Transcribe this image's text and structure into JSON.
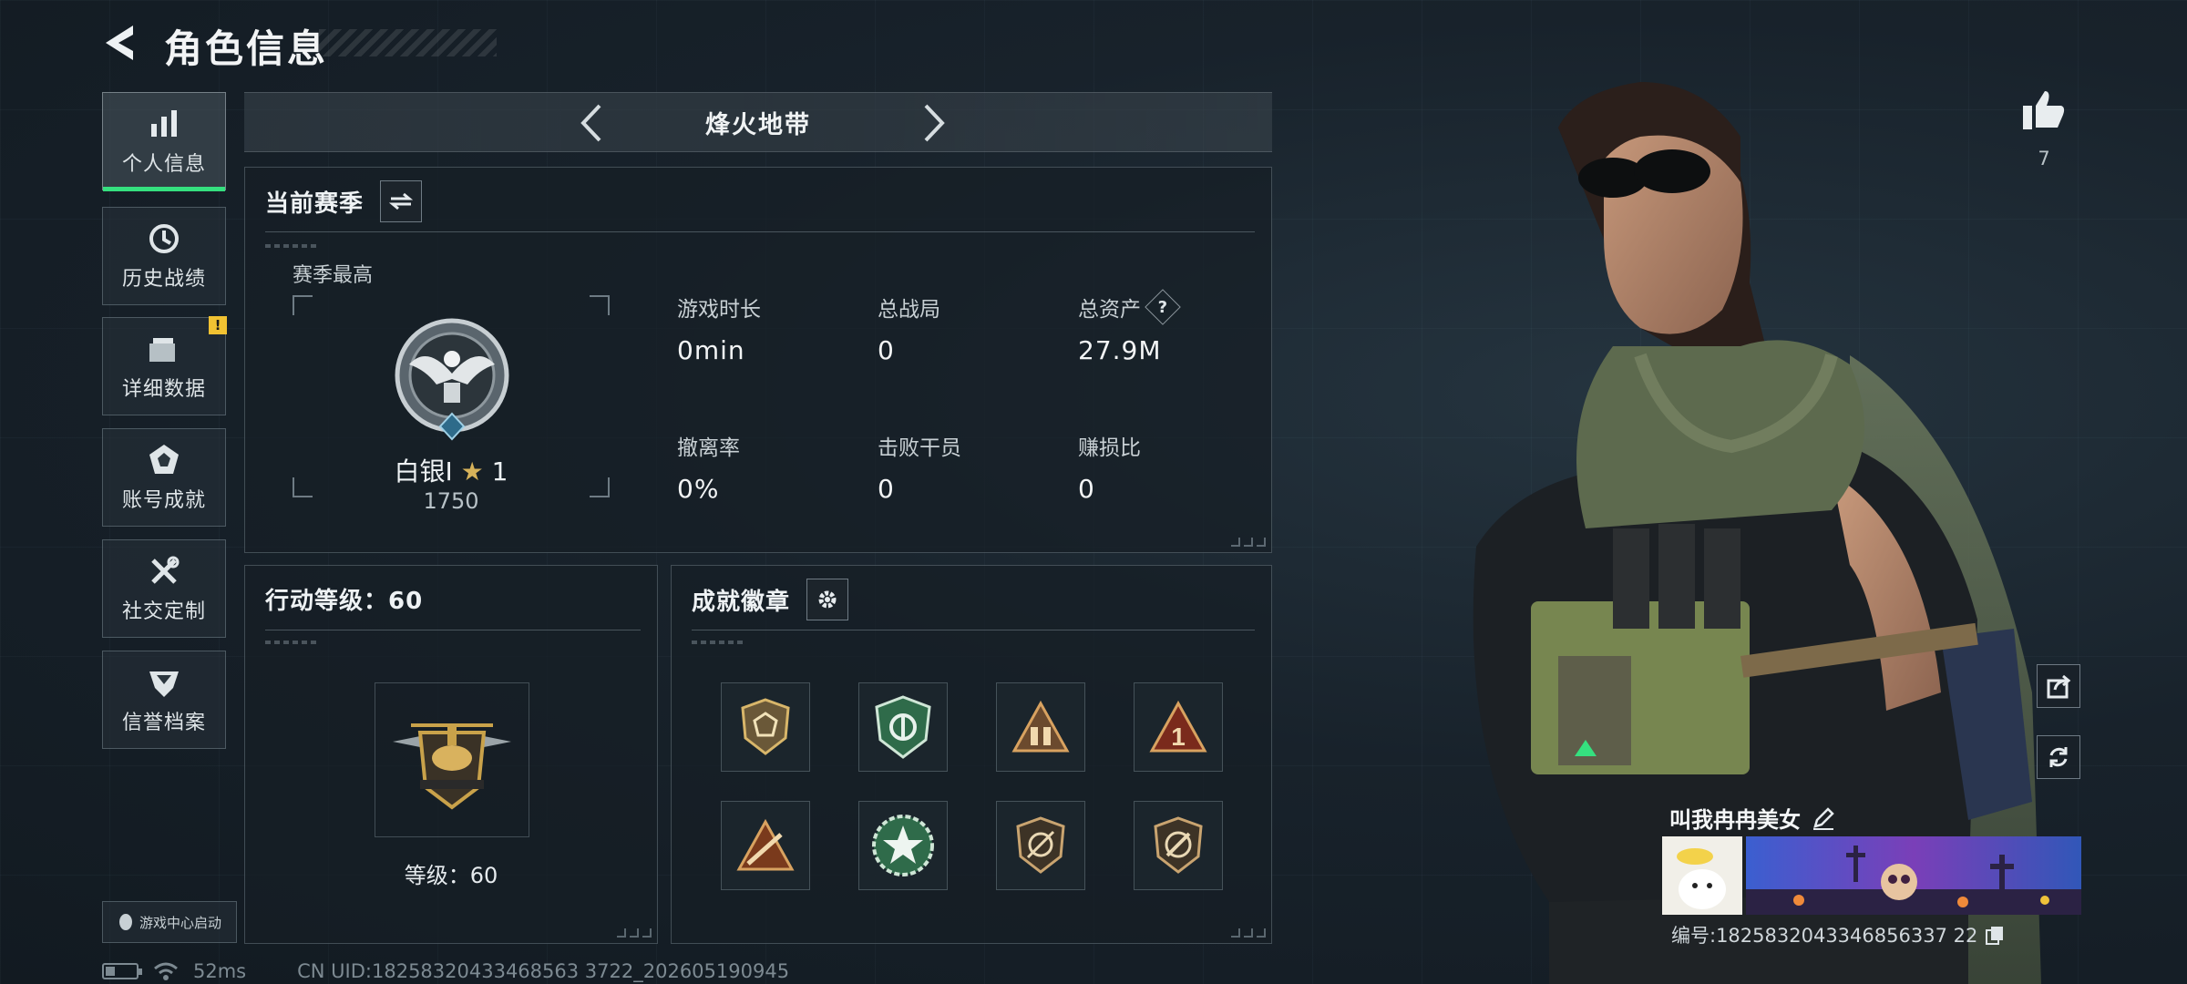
{
  "header": {
    "title": "角色信息"
  },
  "sidebar": {
    "items": [
      {
        "label": "个人信息",
        "icon": "bar-chart-icon",
        "active": true
      },
      {
        "label": "历史战绩",
        "icon": "history-clock-icon"
      },
      {
        "label": "详细数据",
        "icon": "folder-icon",
        "alert": "!"
      },
      {
        "label": "账号成就",
        "icon": "achievement-icon"
      },
      {
        "label": "社交定制",
        "icon": "tools-icon"
      },
      {
        "label": "信誉档案",
        "icon": "shield-badge-icon"
      }
    ],
    "game_center_label": "游戏中心启动"
  },
  "status_bar": {
    "ping": "52ms",
    "uid": "CN UID:18258320433468563 3722_202605190945"
  },
  "mode_bar": {
    "title": "烽火地带"
  },
  "season": {
    "title": "当前赛季",
    "best_label": "赛季最高",
    "rank_name": "白银I",
    "rank_stars": "1",
    "rank_points": "1750",
    "stats": [
      {
        "label": "游戏时长",
        "value": "0min"
      },
      {
        "label": "总战局",
        "value": "0"
      },
      {
        "label": "总资产",
        "value": "27.9M",
        "help": "?"
      },
      {
        "label": "撤离率",
        "value": "0%"
      },
      {
        "label": "击败干员",
        "value": "0"
      },
      {
        "label": "赚损比",
        "value": "0"
      }
    ]
  },
  "action_level": {
    "title": "行动等级：60",
    "level_label": "等级：60"
  },
  "achievement": {
    "title": "成就徽章"
  },
  "character": {
    "likes": "7",
    "nickname": "叫我冉冉美女",
    "id_label": "编号:1825832043346856337 22"
  },
  "colors": {
    "accent": "#35e07f",
    "gold": "#c9a24a",
    "alert": "#f1c232"
  }
}
